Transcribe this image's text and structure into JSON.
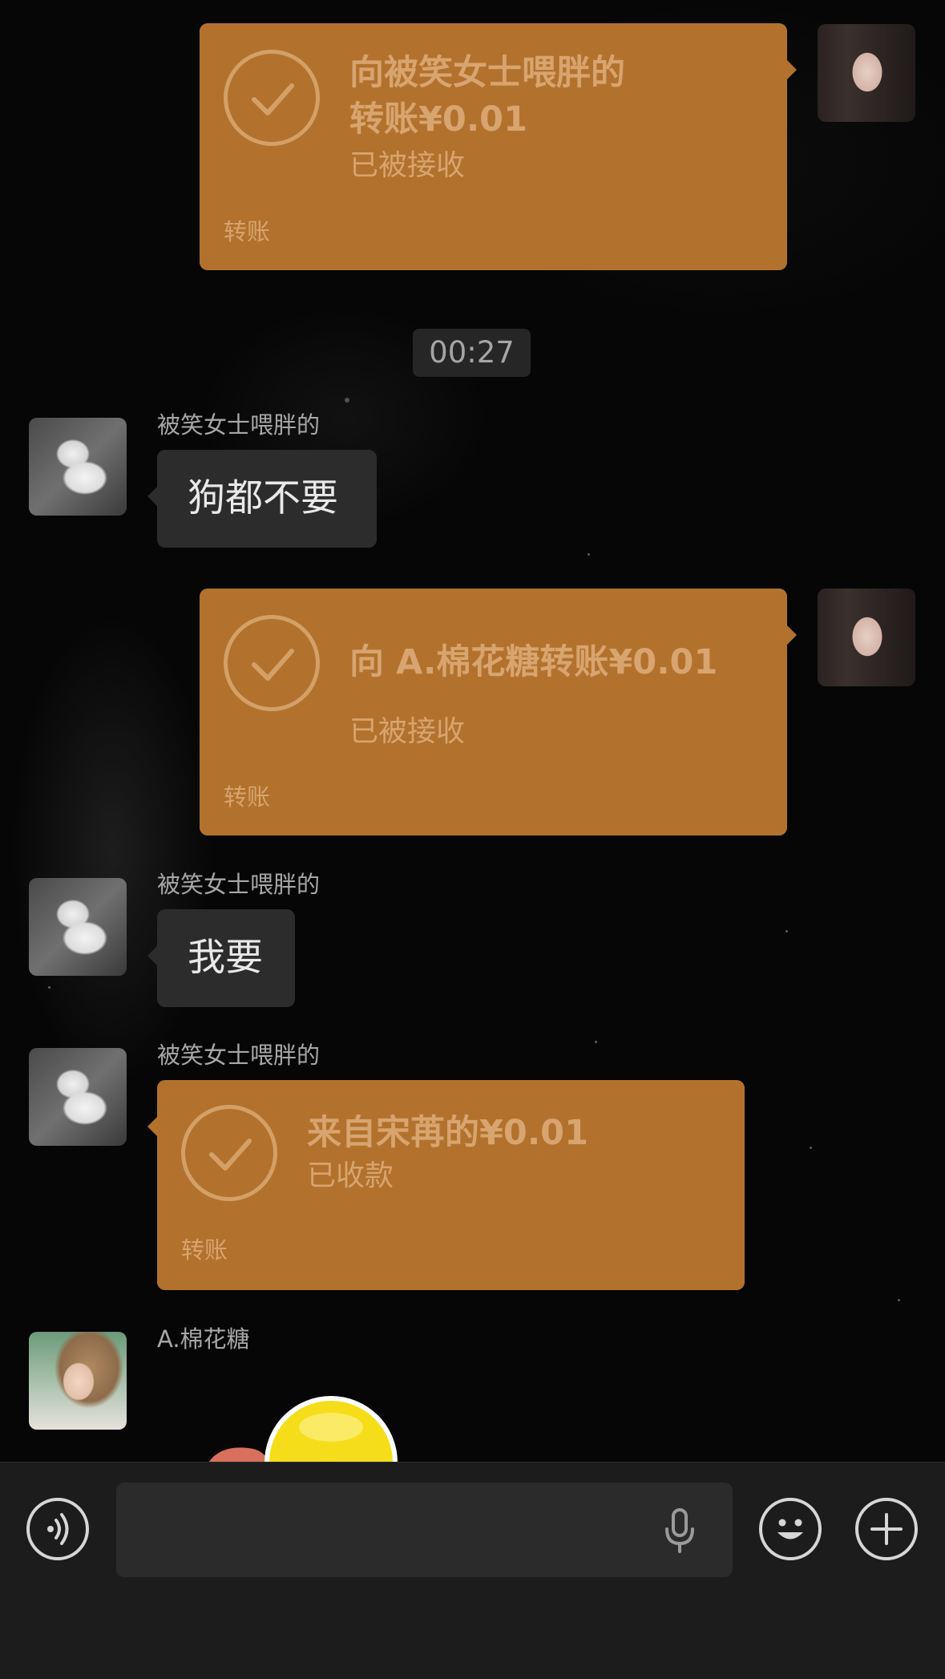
{
  "messages": {
    "transfer1": {
      "title_line1": "向被笑女士喂胖的",
      "title_line2": "转账¥0.01",
      "status": "已被接收",
      "footer": "转账"
    },
    "timestamp": "00:27",
    "msg1": {
      "sender": "被笑女士喂胖的",
      "text": "狗都不要"
    },
    "transfer2": {
      "title": "向 A.棉花糖转账¥0.01",
      "status": "已被接收",
      "footer": "转账"
    },
    "msg2": {
      "sender": "被笑女士喂胖的",
      "text": "我要"
    },
    "transfer3": {
      "sender": "被笑女士喂胖的",
      "title": "来自宋苒的¥0.01",
      "status": "已收款",
      "footer": "转账"
    },
    "msg3": {
      "sender": "A.棉花糖"
    }
  },
  "input_bar": {
    "voice_icon": "voice-icon",
    "mic_icon": "microphone-icon",
    "emoji_icon": "emoji-icon",
    "plus_icon": "plus-icon"
  },
  "colors": {
    "transfer_bubble": "#b2722d",
    "transfer_text": "#d8a46f",
    "text_bubble": "#2c2c2c",
    "background": "#060606"
  }
}
